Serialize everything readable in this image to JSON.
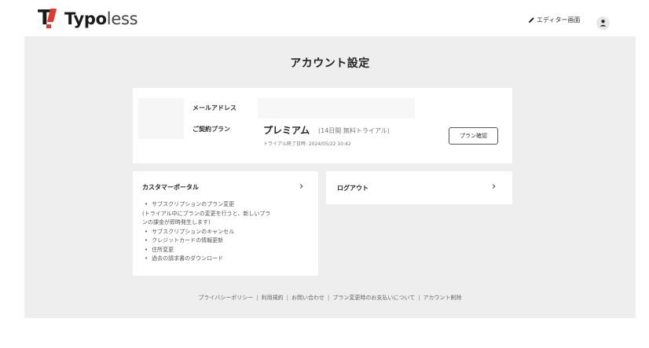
{
  "header": {
    "logo_letters": "T!",
    "logo_bold": "Typo",
    "logo_light": "less",
    "editor_link": "エディター画面"
  },
  "main": {
    "title": "アカウント設定",
    "account": {
      "email_label": "メールアドレス",
      "email_value": "",
      "plan_label": "ご契約プラン",
      "plan_name": "プレミアム",
      "plan_note": "(14日間 無料トライアル)",
      "trial_end": "トライアル終了日時: 2024/05/22 10:42",
      "plan_button": "プラン確認"
    },
    "portal": {
      "title": "カスタマーポータル",
      "chevron": "›",
      "items": [
        "サブスクリプションのプラン変更",
        "(トライアル中にプランの変更を行うと、新しいプラ",
        "ンの課金が即時発生します)",
        "サブスクリプションのキャンセル",
        "クレジットカードの情報更新",
        "住所変更",
        "過去の請求書のダウンロード"
      ]
    },
    "logout": {
      "title": "ログアウト",
      "chevron": "›"
    }
  },
  "footer": {
    "links": [
      "プライバシーポリシー",
      "利用規約",
      "お問い合わせ",
      "プラン変更時のお支払いについて",
      "アカウント削除"
    ],
    "separator": "|"
  },
  "colors": {
    "accent_red": "#e03a2f",
    "background_gray": "#eeeeee"
  }
}
